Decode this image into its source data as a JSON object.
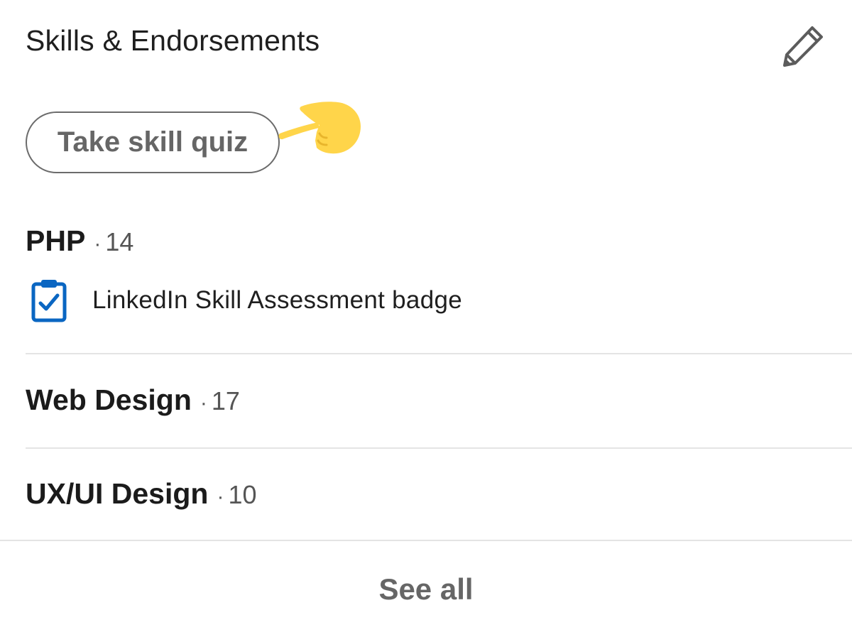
{
  "section": {
    "title": "Skills & Endorsements",
    "edit_icon": "pencil-icon"
  },
  "quiz_button": {
    "label": "Take skill quiz"
  },
  "pointer_icon": "pointing-hand-icon",
  "skills": [
    {
      "name": "PHP",
      "separator": "·",
      "count": "14",
      "badge": {
        "icon": "clipboard-check-icon",
        "text": "LinkedIn Skill Assessment badge"
      }
    },
    {
      "name": "Web Design",
      "separator": "·",
      "count": "17"
    },
    {
      "name": "UX/UI Design",
      "separator": "·",
      "count": "10"
    }
  ],
  "see_all": {
    "label": "See all"
  },
  "colors": {
    "badge_blue": "#0a66c2",
    "emoji_yellow": "#ffd54a",
    "muted_text": "#666666"
  }
}
